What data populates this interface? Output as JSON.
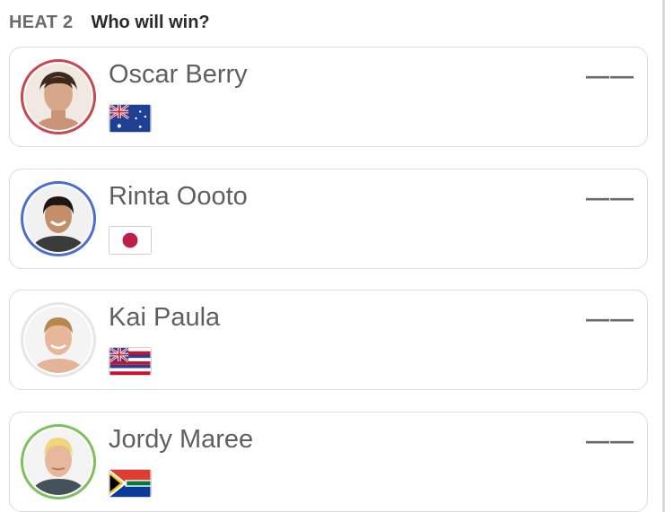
{
  "header": {
    "heat": "HEAT 2",
    "question": "Who will win?"
  },
  "surfers": [
    {
      "name": "Oscar Berry",
      "score": "——",
      "ring_color": "#c9474f",
      "flag": "australia-flag"
    },
    {
      "name": "Rinta Oooto",
      "score": "——",
      "ring_color": "#4a6fcf",
      "flag": "japan-flag"
    },
    {
      "name": "Kai Paula",
      "score": "——",
      "ring_color": "#e6e6e6",
      "flag": "hawaii-flag"
    },
    {
      "name": "Jordy Maree",
      "score": "——",
      "ring_color": "#7cc15a",
      "flag": "south-africa-flag"
    }
  ]
}
